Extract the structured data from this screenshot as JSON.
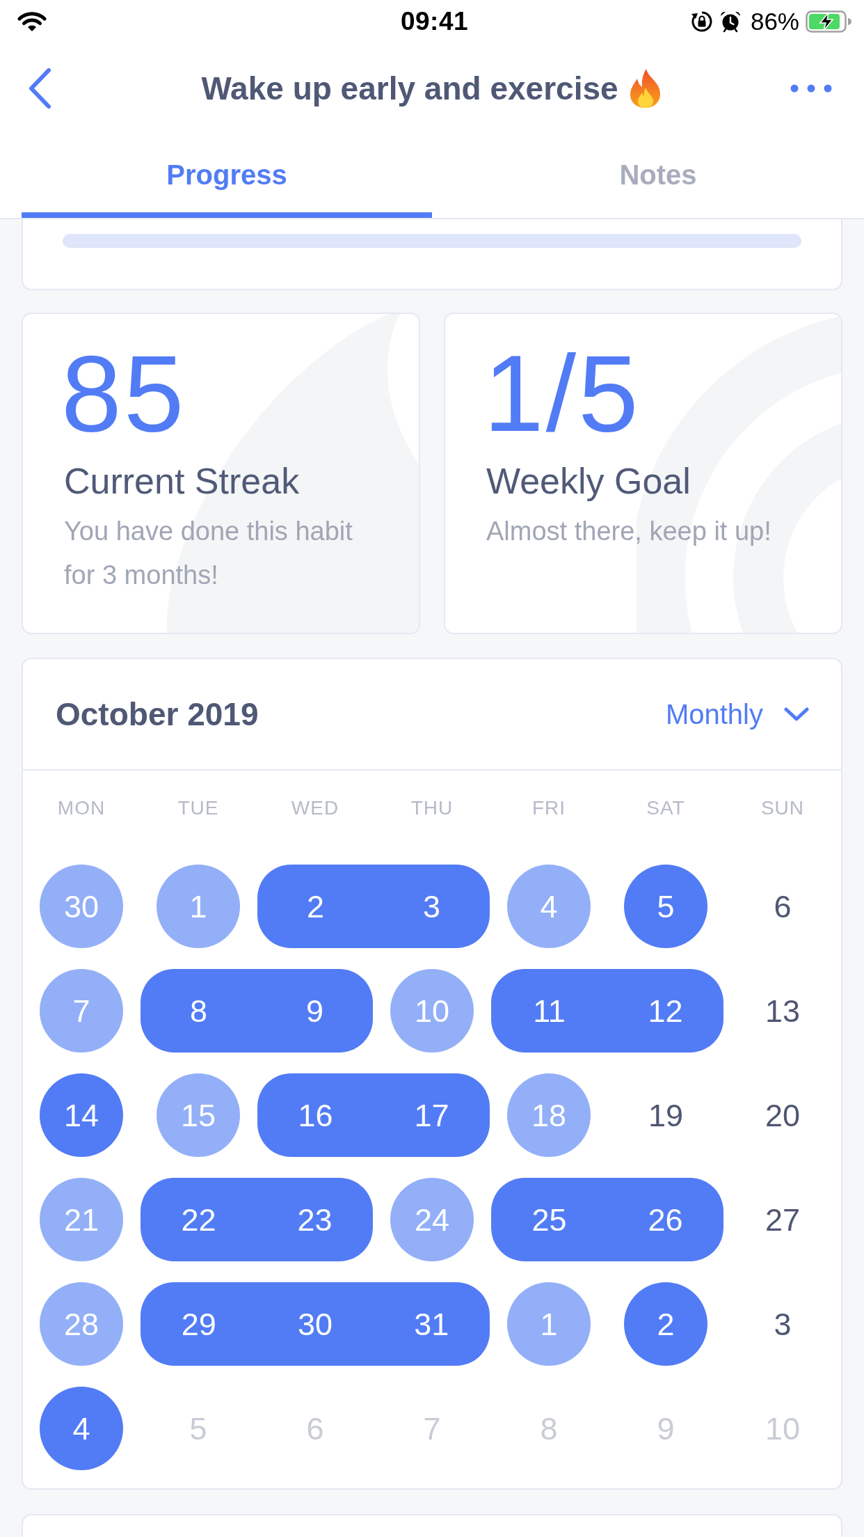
{
  "status_bar": {
    "time": "09:41",
    "battery": "86%"
  },
  "nav": {
    "title": "Wake up early and exercise"
  },
  "tabs": [
    {
      "label": "Progress",
      "selected": true
    },
    {
      "label": "Notes",
      "selected": false
    }
  ],
  "stats": [
    {
      "kind": "streak",
      "value": "85",
      "title": "Current Streak",
      "description": "You have done this habit for 3 months!"
    },
    {
      "kind": "goal",
      "value": "1/5",
      "title": "Weekly Goal",
      "description": "Almost there, keep it up!"
    }
  ],
  "calendar": {
    "month": "October 2019",
    "view": "Monthly",
    "weekdays": [
      "MON",
      "TUE",
      "WED",
      "THU",
      "FRI",
      "SAT",
      "SUN"
    ],
    "weeks": [
      {
        "segments": [
          {
            "kind": "light",
            "muted": false,
            "days": [
              "30"
            ]
          },
          {
            "kind": "light",
            "muted": false,
            "days": [
              "1"
            ]
          },
          {
            "kind": "strong",
            "muted": false,
            "days": [
              "2",
              "3"
            ]
          },
          {
            "kind": "light",
            "muted": false,
            "days": [
              "4"
            ]
          },
          {
            "kind": "strong",
            "muted": false,
            "days": [
              "5"
            ]
          },
          {
            "kind": "plain",
            "muted": false,
            "days": [
              "6"
            ]
          }
        ]
      },
      {
        "segments": [
          {
            "kind": "light",
            "muted": false,
            "days": [
              "7"
            ]
          },
          {
            "kind": "strong",
            "muted": false,
            "days": [
              "8",
              "9"
            ]
          },
          {
            "kind": "light",
            "muted": false,
            "days": [
              "10"
            ]
          },
          {
            "kind": "strong",
            "muted": false,
            "days": [
              "11",
              "12"
            ]
          },
          {
            "kind": "plain",
            "muted": false,
            "days": [
              "13"
            ]
          }
        ]
      },
      {
        "segments": [
          {
            "kind": "strong",
            "muted": false,
            "days": [
              "14"
            ]
          },
          {
            "kind": "light",
            "muted": false,
            "days": [
              "15"
            ]
          },
          {
            "kind": "strong",
            "muted": false,
            "days": [
              "16",
              "17"
            ]
          },
          {
            "kind": "light",
            "muted": false,
            "days": [
              "18"
            ]
          },
          {
            "kind": "plain",
            "muted": false,
            "days": [
              "19"
            ]
          },
          {
            "kind": "plain",
            "muted": false,
            "days": [
              "20"
            ]
          }
        ]
      },
      {
        "segments": [
          {
            "kind": "light",
            "muted": false,
            "days": [
              "21"
            ]
          },
          {
            "kind": "strong",
            "muted": false,
            "days": [
              "22",
              "23"
            ]
          },
          {
            "kind": "light",
            "muted": false,
            "days": [
              "24"
            ]
          },
          {
            "kind": "strong",
            "muted": false,
            "days": [
              "25",
              "26"
            ]
          },
          {
            "kind": "plain",
            "muted": false,
            "days": [
              "27"
            ]
          }
        ]
      },
      {
        "segments": [
          {
            "kind": "light",
            "muted": false,
            "days": [
              "28"
            ]
          },
          {
            "kind": "strong",
            "muted": false,
            "days": [
              "29",
              "30",
              "31"
            ]
          },
          {
            "kind": "light",
            "muted": false,
            "days": [
              "1"
            ]
          },
          {
            "kind": "strong",
            "muted": false,
            "days": [
              "2"
            ]
          },
          {
            "kind": "plain",
            "muted": false,
            "days": [
              "3"
            ]
          }
        ]
      },
      {
        "segments": [
          {
            "kind": "strong",
            "muted": false,
            "days": [
              "4"
            ]
          },
          {
            "kind": "plain",
            "muted": true,
            "days": [
              "5"
            ]
          },
          {
            "kind": "plain",
            "muted": true,
            "days": [
              "6"
            ]
          },
          {
            "kind": "plain",
            "muted": true,
            "days": [
              "7"
            ]
          },
          {
            "kind": "plain",
            "muted": true,
            "days": [
              "8"
            ]
          },
          {
            "kind": "plain",
            "muted": true,
            "days": [
              "9"
            ]
          },
          {
            "kind": "plain",
            "muted": true,
            "days": [
              "10"
            ]
          }
        ]
      }
    ]
  }
}
